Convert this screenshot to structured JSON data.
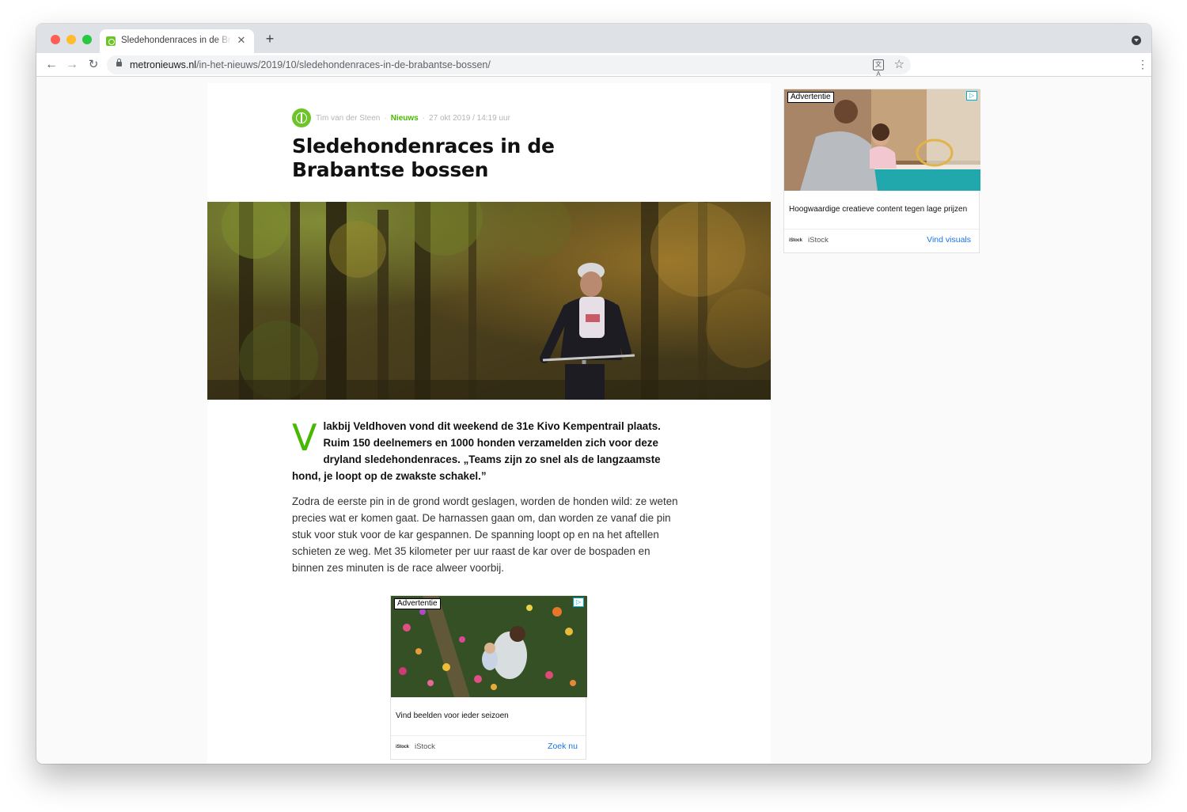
{
  "browser": {
    "tab_title": "Sledehondenraces in de Brabantse bossen",
    "new_tab_icon": "plus-icon",
    "url_host": "metronieuws.nl",
    "url_path": "/in-het-nieuws/2019/10/sledehondenraces-in-de-brabantse-bossen/"
  },
  "article": {
    "author": "Tim van der Steen",
    "category": "Nieuws",
    "date": "27 okt 2019 / 14:19 uur",
    "title": "Sledehondenraces in de Brabantse bossen",
    "hero_icon": "mountain-biker-forest-photo",
    "lead_dropcap": "V",
    "lead_rest": "lakbij Veldhoven vond dit weekend de 31e Kivo Kempentrail plaats. Ruim 150 deelnemers en 1000 honden verzamelden zich voor deze dryland sledehondenraces. „Teams zijn zo snel als de langzaamste hond, je loopt op de zwakste schakel.”",
    "paragraph": "Zodra de eerste pin in de grond wordt geslagen, worden de honden wild: ze weten precies wat er komen gaat. De harnassen gaan om, dan worden ze vanaf die pin stuk voor stuk voor de kar gespannen. De spanning loopt op en na het aftellen schieten ze weg. Met 35 kilometer per uur raast de kar over de bospaden en binnen zes minuten is de race alweer voorbij."
  },
  "ad_side": {
    "label": "Advertentie",
    "text": "Hoogwaardige creatieve content tegen lage prijzen",
    "logo": "iStock",
    "brand": "iStock",
    "cta": "Vind visuals"
  },
  "ad_inline": {
    "label": "Advertentie",
    "text": "Vind beelden voor ieder seizoen",
    "logo": "iStock",
    "brand": "iStock",
    "cta": "Zoek nu"
  },
  "colors": {
    "accent": "#47b800",
    "link": "#1a73e8"
  }
}
